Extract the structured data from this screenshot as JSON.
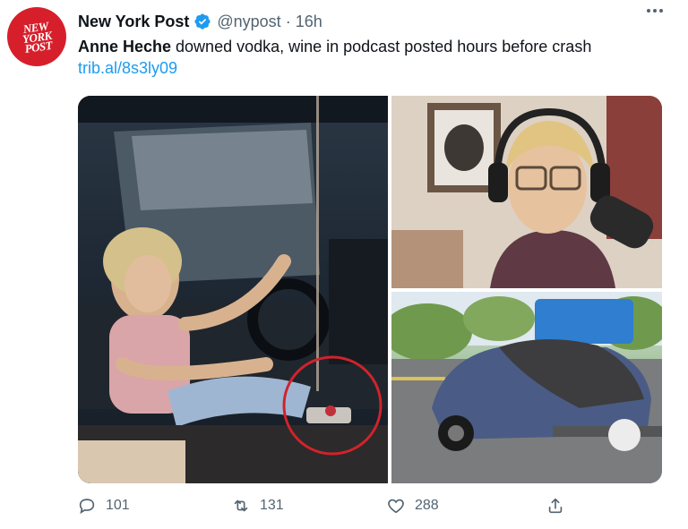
{
  "account": {
    "name": "New York Post",
    "handle": "@nypost",
    "separator": "·",
    "time": "16h",
    "avatar_text": "NEW YORK POST",
    "avatar_color": "#d71f2b",
    "verified_color": "#1d9bf0"
  },
  "tweet": {
    "subject": "Anne Heche",
    "body": " downed vodka, wine in podcast posted hours before crash",
    "link": "trib.al/8s3ly09"
  },
  "media": {
    "image_count": 3
  },
  "actions": {
    "reply_count": "101",
    "retweet_count": "131",
    "like_count": "288"
  },
  "icons": [
    "more-icon",
    "verified-icon",
    "reply-icon",
    "retweet-icon",
    "like-icon",
    "share-icon"
  ]
}
